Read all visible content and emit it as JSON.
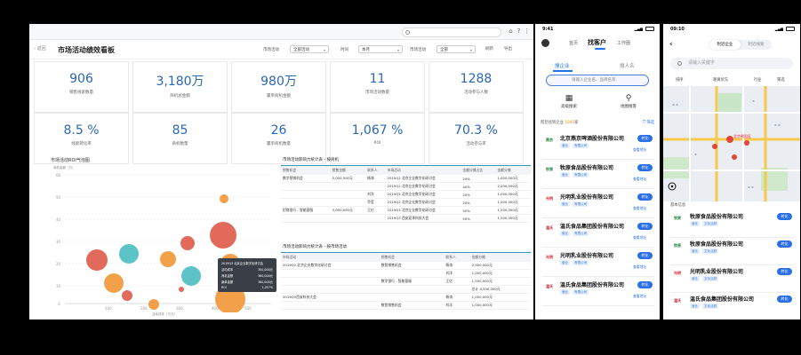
{
  "desktop": {
    "search_placeholder": "",
    "tools": [
      "⌂",
      "?",
      "⋮"
    ],
    "back": "‹ 返回",
    "title": "市场活动绩效看板",
    "filters": [
      {
        "label": "市场活动",
        "value": "全部活动"
      },
      {
        "label": "时间",
        "value": "本月"
      },
      {
        "label": "市场活动",
        "value": "全部"
      }
    ],
    "extras": [
      "刷新",
      "导出"
    ],
    "kpis": [
      {
        "value": "906",
        "label": "销售线索数量"
      },
      {
        "value": "3,180万",
        "label": "商机总金额"
      },
      {
        "value": "980万",
        "label": "赢单商机金额"
      },
      {
        "value": "11",
        "label": "市场活动数量"
      },
      {
        "value": "1288",
        "label": "活动参与人数"
      },
      {
        "value": "8.5 %",
        "label": "线索转化率"
      },
      {
        "value": "85",
        "label": "商机数量"
      },
      {
        "value": "26",
        "label": "赢单商机数量"
      },
      {
        "value": "1,067 %",
        "label": "ROI"
      },
      {
        "value": "70.3 %",
        "label": "活动参与率"
      }
    ],
    "bubble_chart": {
      "title": "市场活动ROI气泡图",
      "ylabel": "商机金额（万）",
      "xlabel": "活动成本（万元）"
    },
    "tooltip": {
      "title": "2019Q3 北京企业数字化研讨会",
      "rows": [
        {
          "k": "活动成本",
          "v": "300,000元"
        },
        {
          "k": "商机金额",
          "v": "360,000元"
        },
        {
          "k": "赢单金额",
          "v": "360,000元"
        },
        {
          "k": "ROI",
          "v": "1,057%"
        }
      ]
    },
    "table1": {
      "title": "市场活动影响力统计表 - 按商机",
      "headers": [
        "销售机会",
        "销售金额",
        "联系人",
        "市场活动",
        "金额分摊占比",
        "金额分摊"
      ],
      "rows": [
        [
          "数字营销机会",
          "5,000,000元",
          "杨涛",
          "2019Q2 北京企业数字化研讨会",
          "20%",
          "1,000,000元"
        ],
        [
          "",
          "",
          "",
          "2019Q2 北京企业数字化研讨会",
          "40%",
          "2,000,000元"
        ],
        [
          "",
          "",
          "刘洋",
          "2019Q2 北京企业数字化研讨会",
          "20%",
          "1,000,000元"
        ],
        [
          "",
          "",
          "乔莹",
          "2019Q2 北京企业数字化研讨会",
          "20%",
          "1,000,000元"
        ],
        [
          "招商银行 - 智能客服",
          "3,000,000元",
          "王亿",
          "2019Q3 北京企业数字化研讨会",
          "50%",
          "1,500,000元"
        ],
        [
          "",
          "",
          "",
          "2019Q3 西安夏季科技大会",
          "50%",
          "1,500,000元"
        ]
      ]
    },
    "table2": {
      "title": "市场活动影响力统计表 - 按市场活动",
      "headers": [
        "市场活动",
        "销售机会",
        "联系人",
        "金额分摊"
      ],
      "rows": [
        [
          "2019Q2 北京企业数字化研讨会",
          "数智销售机会",
          "杨涛",
          "2,000,000元"
        ],
        [
          "",
          "",
          "刘洋",
          "1,000,000元"
        ],
        [
          "",
          "数字银行 - 智能客服",
          "王亿",
          "1,500,000元"
        ],
        [
          "",
          "",
          "",
          "总计  4,500,000元"
        ],
        [
          "2019Q3西安科技大会",
          "",
          "杨涛",
          "1,000,000元"
        ],
        [
          "",
          "数智销售机会",
          "刘洋",
          "1,000,000元"
        ]
      ]
    }
  },
  "phone1": {
    "time": "9:41",
    "signal": "▂▄▆",
    "tabs": [
      "首页",
      "找客户",
      "工作圈"
    ],
    "subtabs": [
      "搜企业",
      "搜人名"
    ],
    "search_placeholder": "请输入企业名、品牌名等",
    "icons": [
      {
        "g": "▦",
        "label": "高级搜索"
      },
      {
        "g": "⚲",
        "label": "地图搜客"
      }
    ],
    "result_prefix": "帮您找到企业",
    "result_count": "1000",
    "result_suffix": "家",
    "filter": "筛选",
    "companies": [
      {
        "name": "北京燕京啤酒股份有限公司",
        "logo": "燕京",
        "tags": [
          "营业",
          "有限公司"
        ],
        "btn": "转化"
      },
      {
        "name": "牧原食品股份有限公司",
        "logo": "牧原",
        "tags": [
          "营业",
          "有限公司"
        ],
        "btn": "转化"
      },
      {
        "name": "光明乳业股份有限公司",
        "logo": "光明",
        "tags": [
          "营业",
          "有限公司"
        ],
        "btn": "转化"
      },
      {
        "name": "温氏食品集团股份有限公司",
        "logo": "温氏",
        "tags": [
          "营业",
          "有限公司"
        ],
        "btn": "转化"
      },
      {
        "name": "光明乳业股份有限公司",
        "logo": "光明",
        "tags": [
          "营业",
          "有限公司"
        ],
        "btn": "转化"
      },
      {
        "name": "温氏食品集团股份有限公司",
        "logo": "温氏",
        "tags": [
          "营业",
          "有限公司"
        ],
        "btn": "转化"
      }
    ],
    "link": "查看地址"
  },
  "phone2": {
    "time": "09:10",
    "signal": "▂▄▆",
    "seg": [
      "附近企业",
      "附近线索"
    ],
    "search_placeholder": "请输入关键字",
    "filters": [
      "排序",
      "距离优先",
      "行业",
      "筛选"
    ],
    "map_place": "北京朝阳区",
    "list_header": "基本信息",
    "companies": [
      {
        "name": "牧原食品股份有限公司",
        "logo": "牧原",
        "tags": [
          "营业",
          "文化活跃"
        ],
        "btn": "转化"
      },
      {
        "name": "牧原食品股份有限公司",
        "logo": "牧原",
        "tags": [
          "营业",
          "文化活跃"
        ],
        "btn": "转化"
      },
      {
        "name": "光明乳业股份有限公司",
        "logo": "光明",
        "tags": [
          "营业",
          "文化活跃"
        ],
        "btn": "转化"
      },
      {
        "name": "温氏食品集团股份有限公司",
        "logo": "温氏",
        "tags": [
          "营业",
          "文化活跃"
        ],
        "btn": "转化"
      }
    ]
  },
  "colors": {
    "accent": "#1f6feb",
    "kpi": "#2a66b8",
    "bubble_red": "#e26a5a",
    "bubble_orange": "#f2a14a",
    "bubble_teal": "#5cc3c6"
  }
}
